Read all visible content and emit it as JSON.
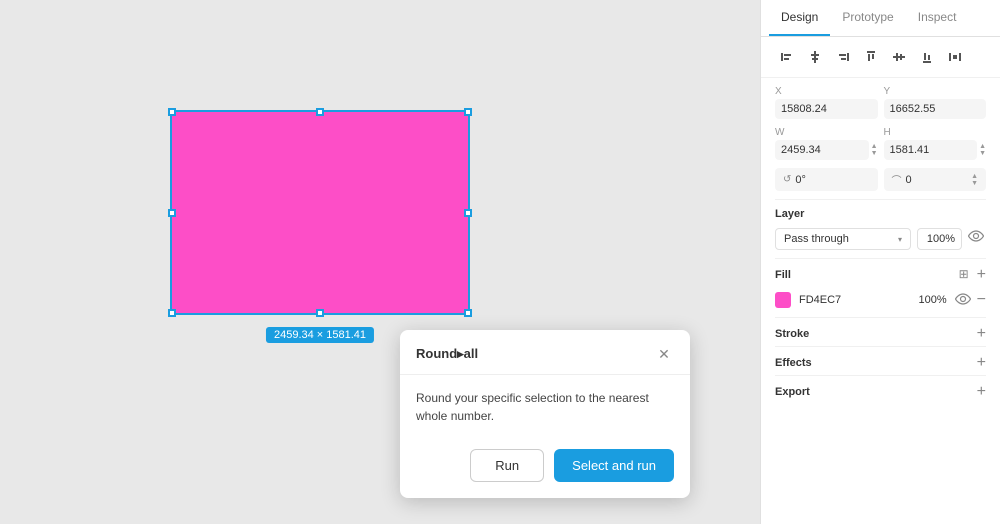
{
  "panel": {
    "tabs": [
      {
        "id": "design",
        "label": "Design",
        "active": true
      },
      {
        "id": "prototype",
        "label": "Prototype",
        "active": false
      },
      {
        "id": "inspect",
        "label": "Inspect",
        "active": false
      }
    ],
    "alignment": {
      "icons": [
        "⊢",
        "+",
        "⊣",
        "⊤",
        "⊥",
        "|||"
      ]
    },
    "position": {
      "x_label": "X",
      "x_value": "15808.24",
      "y_label": "Y",
      "y_value": "16652.55"
    },
    "size": {
      "w_label": "W",
      "w_value": "2459.34",
      "h_label": "H",
      "h_value": "1581.41"
    },
    "rotation": {
      "angle": "0°",
      "corner_radius": "0"
    },
    "layer": {
      "title": "Layer",
      "blend_mode": "Pass through",
      "opacity": "100%"
    },
    "fill": {
      "title": "Fill",
      "color": "#FD4EC7",
      "hex": "FD4EC7",
      "opacity": "100%"
    },
    "stroke": {
      "title": "Stroke"
    },
    "effects": {
      "title": "Effects"
    },
    "export": {
      "title": "Export"
    }
  },
  "canvas": {
    "size_label": "2459.34 × 1581.41"
  },
  "dialog": {
    "title": "Round▸all",
    "description": "Round your specific selection to the nearest whole number.",
    "run_label": "Run",
    "select_and_run_label": "Select and run",
    "close_label": "✕"
  }
}
